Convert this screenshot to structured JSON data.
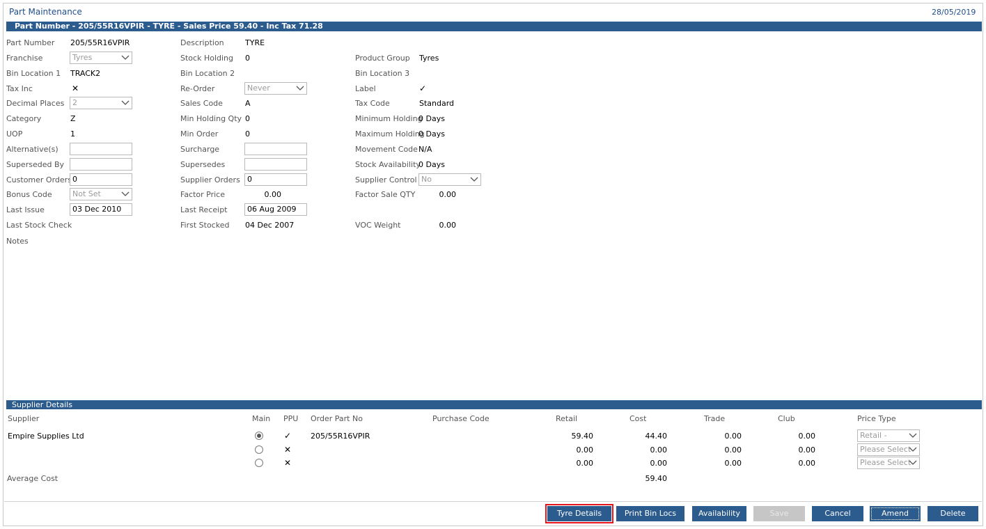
{
  "window": {
    "title": "Part Maintenance",
    "date": "28/05/2019"
  },
  "header_bar": "Part Number - 205/55R16VPIR - TYRE - Sales Price 59.40 - Inc Tax 71.28",
  "col1": {
    "part_number": {
      "label": "Part Number",
      "value": "205/55R16VPIR"
    },
    "franchise": {
      "label": "Franchise",
      "value": "Tyres"
    },
    "bin_location_1": {
      "label": "Bin Location 1",
      "value": "TRACK2"
    },
    "tax_inc": {
      "label": "Tax Inc",
      "value": "✕"
    },
    "decimal_places": {
      "label": "Decimal Places",
      "value": "2"
    },
    "category": {
      "label": "Category",
      "value": "Z"
    },
    "uop": {
      "label": "UOP",
      "value": "1"
    },
    "alternatives": {
      "label": "Alternative(s)",
      "value": ""
    },
    "superseded_by": {
      "label": "Superseded By",
      "value": ""
    },
    "customer_orders": {
      "label": "Customer Orders",
      "value": "0"
    },
    "bonus_code": {
      "label": "Bonus Code",
      "value": "Not Set"
    },
    "last_issue": {
      "label": "Last Issue",
      "value": "03 Dec 2010"
    },
    "last_stock_check": {
      "label": "Last Stock Check",
      "value": ""
    },
    "notes": {
      "label": "Notes",
      "value": ""
    }
  },
  "col2": {
    "description": {
      "label": "Description",
      "value": "TYRE"
    },
    "stock_holding": {
      "label": "Stock Holding",
      "value": "0"
    },
    "bin_location_2": {
      "label": "Bin Location 2",
      "value": ""
    },
    "re_order": {
      "label": "Re-Order",
      "value": "Never"
    },
    "sales_code": {
      "label": "Sales Code",
      "value": "A"
    },
    "min_holding_qty": {
      "label": "Min Holding Qty",
      "value": "0"
    },
    "min_order": {
      "label": "Min Order",
      "value": "0"
    },
    "surcharge": {
      "label": "Surcharge",
      "value": ""
    },
    "supersedes": {
      "label": "Supersedes",
      "value": ""
    },
    "supplier_orders": {
      "label": "Supplier Orders",
      "value": "0"
    },
    "factor_price": {
      "label": "Factor Price",
      "value": "0.00"
    },
    "last_receipt": {
      "label": "Last Receipt",
      "value": "06 Aug 2009"
    },
    "first_stocked": {
      "label": "First Stocked",
      "value": "04 Dec 2007"
    }
  },
  "col3": {
    "product_group": {
      "label": "Product Group",
      "value": "Tyres"
    },
    "bin_location_3": {
      "label": "Bin Location 3",
      "value": ""
    },
    "label": {
      "label": "Label",
      "value": "✓"
    },
    "tax_code": {
      "label": "Tax Code",
      "value": "Standard"
    },
    "minimum_holding": {
      "label": "Minimum Holding",
      "value": "0 Days"
    },
    "maximum_holding": {
      "label": "Maximum Holding",
      "value": "0 Days"
    },
    "movement_code": {
      "label": "Movement Code",
      "value": "N/A"
    },
    "stock_availability": {
      "label": "Stock Availability",
      "value": "0 Days"
    },
    "supplier_control": {
      "label": "Supplier Control",
      "value": "No"
    },
    "factor_sale_qty": {
      "label": "Factor Sale QTY",
      "value": "0.00"
    },
    "voc_weight": {
      "label": "VOC Weight",
      "value": "0.00"
    }
  },
  "supplier_section": {
    "title": "Supplier Details",
    "headers": {
      "supplier": "Supplier",
      "main": "Main",
      "ppu": "PPU",
      "order_part_no": "Order Part No",
      "purchase_code": "Purchase Code",
      "retail": "Retail",
      "cost": "Cost",
      "trade": "Trade",
      "club": "Club",
      "price_type": "Price Type"
    },
    "rows": [
      {
        "supplier": "Empire Supplies Ltd",
        "main": true,
        "ppu": "✓",
        "order_part_no": "205/55R16VPIR",
        "purchase_code": "",
        "retail": "59.40",
        "cost": "44.40",
        "trade": "0.00",
        "club": "0.00",
        "price_type": "Retail -"
      },
      {
        "supplier": "",
        "main": false,
        "ppu": "✕",
        "order_part_no": "",
        "purchase_code": "",
        "retail": "0.00",
        "cost": "0.00",
        "trade": "0.00",
        "club": "0.00",
        "price_type": "Please Select"
      },
      {
        "supplier": "",
        "main": false,
        "ppu": "✕",
        "order_part_no": "",
        "purchase_code": "",
        "retail": "0.00",
        "cost": "0.00",
        "trade": "0.00",
        "club": "0.00",
        "price_type": "Please Select"
      }
    ],
    "average_cost": {
      "label": "Average Cost",
      "value": "59.40"
    }
  },
  "buttons": {
    "tyre_details": "Tyre Details",
    "print_bin_locs": "Print Bin Locs",
    "availability": "Availability",
    "save": "Save",
    "cancel": "Cancel",
    "amend": "Amend",
    "delete": "Delete"
  },
  "colors": {
    "accent": "#2c5b8e",
    "title": "#1f4e8c",
    "highlight": "#e8141c"
  }
}
